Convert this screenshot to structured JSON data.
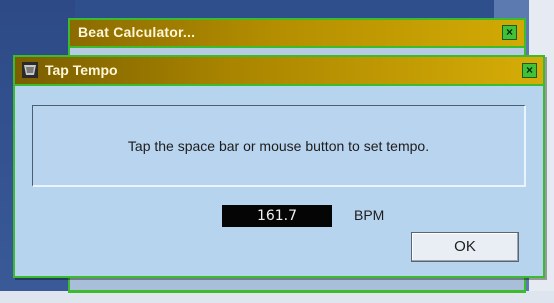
{
  "background_window": {
    "title": "Beat Calculator...",
    "close_glyph": "×"
  },
  "dialog": {
    "title": "Tap Tempo",
    "icon": "tap-tempo-app-icon",
    "close_glyph": "×",
    "message": "Tap the space bar or mouse button to set tempo.",
    "bpm_value": "161.7",
    "bpm_unit": "BPM",
    "ok_label": "OK"
  },
  "colors": {
    "titlebar_gold": "#b48e00",
    "window_border_green": "#3dbb2f",
    "dialog_body": "#b6d4ee",
    "desktop": "#2f4e8c"
  }
}
